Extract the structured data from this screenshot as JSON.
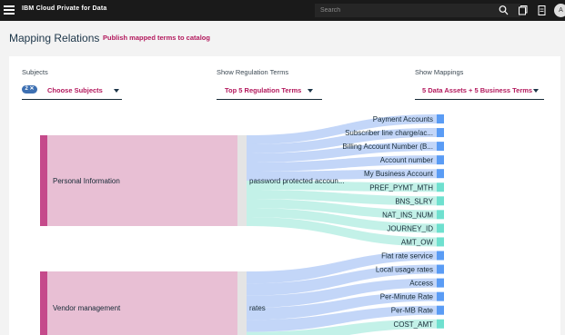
{
  "topbar": {
    "brand": "IBM Cloud Private for Data",
    "search_placeholder": "Search",
    "icons": [
      "menu-icon",
      "search-icon",
      "catalog-icon",
      "notification-icon"
    ],
    "avatar_initial": "A"
  },
  "header": {
    "title": "Mapping Relations",
    "publish_label": "Publish mapped terms to catalog"
  },
  "filters": {
    "subjects": {
      "label": "Subjects",
      "badge": "2 ✕",
      "value": "Choose Subjects"
    },
    "regulation": {
      "label": "Show Regulation Terms",
      "value": "Top 5 Regulation Terms"
    },
    "mappings": {
      "label": "Show Mappings",
      "value": "5 Data Assets + 5 Business Terms"
    }
  },
  "colors": {
    "accent": "#b3195d",
    "subject_bar": "#c54a8b",
    "subject_fill": "#e8bfd4",
    "data_asset": "#5a9cf5",
    "business_term": "#6fe0cf",
    "data_asset_flow": "#bcd2f7",
    "business_term_flow": "#bdf0e6"
  },
  "sankey": {
    "subjects": [
      "Personal Information",
      "Vendor management"
    ],
    "regulation_terms": [
      "password protected accoun...",
      "rates"
    ],
    "targets": [
      {
        "label": "Payment Accounts",
        "kind": "data_asset"
      },
      {
        "label": "Subscriber line charge/ac...",
        "kind": "data_asset"
      },
      {
        "label": "Billing Account Number (B...",
        "kind": "data_asset"
      },
      {
        "label": "Account number",
        "kind": "data_asset"
      },
      {
        "label": "My Business Account",
        "kind": "data_asset"
      },
      {
        "label": "PREF_PYMT_MTH",
        "kind": "business_term"
      },
      {
        "label": "BNS_SLRY",
        "kind": "business_term"
      },
      {
        "label": "NAT_INS_NUM",
        "kind": "business_term"
      },
      {
        "label": "JOURNEY_ID",
        "kind": "business_term"
      },
      {
        "label": "AMT_OW",
        "kind": "business_term"
      },
      {
        "label": "Flat rate service",
        "kind": "data_asset"
      },
      {
        "label": "Local usage rates",
        "kind": "data_asset"
      },
      {
        "label": "Access",
        "kind": "data_asset"
      },
      {
        "label": "Per-Minute Rate",
        "kind": "data_asset"
      },
      {
        "label": "Per-MB Rate",
        "kind": "data_asset"
      },
      {
        "label": "COST_AMT",
        "kind": "business_term"
      }
    ]
  }
}
